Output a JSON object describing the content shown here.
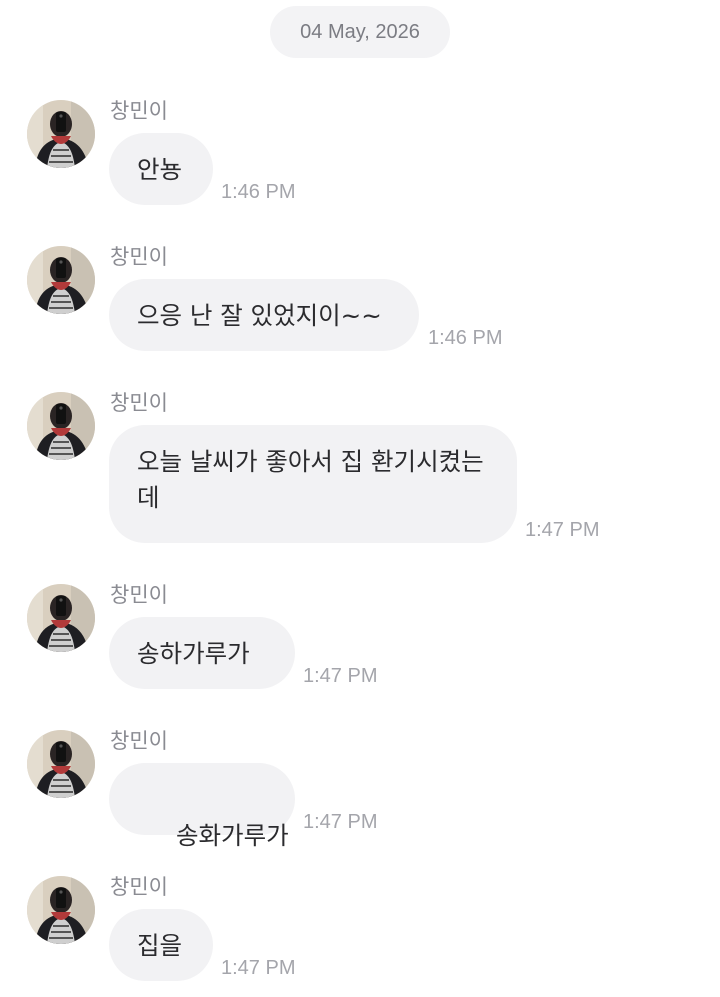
{
  "date_divider": "04 May, 2026",
  "sender_name": "창민이",
  "messages": [
    {
      "sender": "창민이",
      "text": "안뇽",
      "time": "1:46 PM"
    },
    {
      "sender": "창민이",
      "text": "으응 난 잘 있었지이~~",
      "time": "1:46 PM"
    },
    {
      "sender": "창민이",
      "text": "오늘 날씨가 좋아서 집 환기시켰는데",
      "time": "1:47 PM"
    },
    {
      "sender": "창민이",
      "text": "송하가루가",
      "time": "1:47 PM"
    },
    {
      "sender": "창민이",
      "text": " 송화가루가",
      "time": "1:47 PM"
    },
    {
      "sender": "창민이",
      "text": "집을",
      "time": "1:47 PM"
    }
  ],
  "colors": {
    "bubble": "#f2f2f4",
    "date_pill": "#f3f3f5",
    "text": "#2b2b2e",
    "meta": "#a4a5ab"
  },
  "icons": {
    "avatar": "profile-photo"
  }
}
